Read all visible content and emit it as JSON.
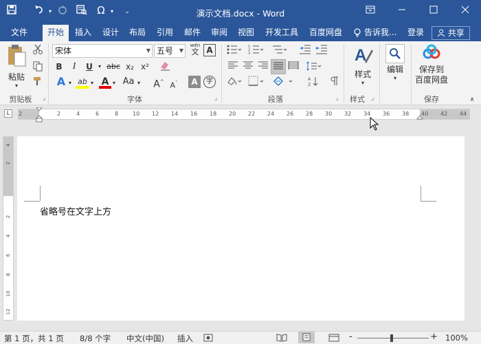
{
  "window": {
    "title": "演示文档.docx - Word",
    "quick_access": {
      "save": "save-icon",
      "undo": "undo-icon",
      "redo": "redo-icon",
      "print_preview": "print-preview-icon",
      "symbol": "Ω",
      "customize": "customize-icon"
    },
    "controls": {
      "ribbon_options": "ribbon-display-icon",
      "minimize": "minimize-icon",
      "maximize": "maximize-icon",
      "close": "close-icon"
    }
  },
  "ribbon": {
    "tabs": [
      "文件",
      "开始",
      "插入",
      "设计",
      "布局",
      "引用",
      "邮件",
      "审阅",
      "视图",
      "开发工具",
      "百度网盘"
    ],
    "active_tab": "开始",
    "tell_me": "告诉我...",
    "login": "登录",
    "share": "共享",
    "clipboard": {
      "label": "剪贴板",
      "paste": "粘贴"
    },
    "font": {
      "label": "字体",
      "family": "宋体",
      "size": "五号",
      "wen": "wén",
      "wen_char": "文",
      "change_case": "Aa",
      "bold": "B",
      "italic": "I",
      "underline": "U",
      "strike": "abc",
      "subscript": "x₂",
      "superscript": "x²",
      "grow": "A",
      "shrink": "A",
      "char_shading": "A",
      "char_border": "字",
      "text_effects": "A",
      "highlight": "ab",
      "font_color": "A"
    },
    "paragraph": {
      "label": "段落"
    },
    "styles": {
      "label": "样式",
      "button": "样式"
    },
    "editing": {
      "button": "编辑"
    },
    "save": {
      "label": "保存",
      "button_line1": "保存到",
      "button_line2": "百度网盘"
    },
    "colors": {
      "brand": "#2b579a",
      "highlight": "#ffff00",
      "font_color": "#e00000",
      "baidu_blue": "#2e8ae6"
    }
  },
  "ruler": {
    "ticks": [
      "2",
      "2",
      "4",
      "6",
      "8",
      "10",
      "12",
      "14",
      "16",
      "18",
      "20",
      "22",
      "24",
      "26",
      "28",
      "30",
      "32",
      "34",
      "36",
      "38",
      "40",
      "42",
      "44"
    ],
    "vertical_ticks": [
      "4",
      "2",
      "2",
      "4",
      "6",
      "8",
      "10",
      "12",
      "14",
      "16",
      "18"
    ]
  },
  "document": {
    "text": "省略号在文字上方"
  },
  "status": {
    "page": "第 1 页，共 1 页",
    "words": "8/8 个字",
    "language": "中文(中国)",
    "mode": "插入",
    "zoom": "100%",
    "zoom_minus": "-",
    "zoom_plus": "+"
  }
}
